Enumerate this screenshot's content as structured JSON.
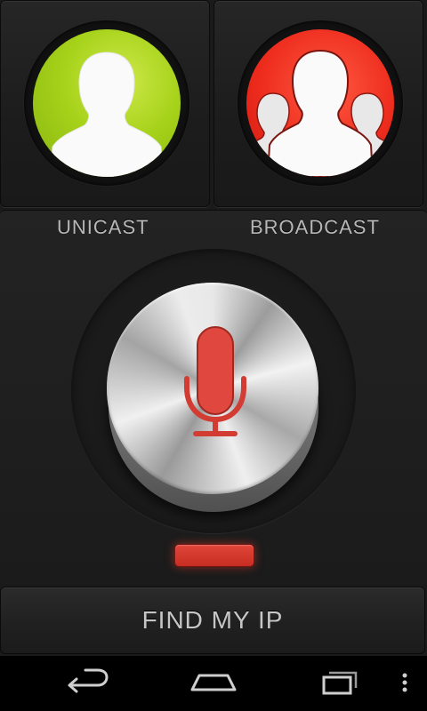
{
  "modes": {
    "unicast": {
      "label": "UNICAST",
      "icon": "single-person-icon",
      "color": "#a6d21a"
    },
    "broadcast": {
      "label": "BROADCAST",
      "icon": "group-people-icon",
      "color": "#ee2d1e"
    }
  },
  "talk": {
    "icon": "microphone-icon",
    "mic_color": "#e0483f",
    "status_color": "#d63a2e"
  },
  "find_ip": {
    "label": "FIND MY IP"
  },
  "nav": {
    "back": "back-icon",
    "home": "home-icon",
    "recents": "recent-apps-icon",
    "menu": "overflow-menu-icon"
  }
}
